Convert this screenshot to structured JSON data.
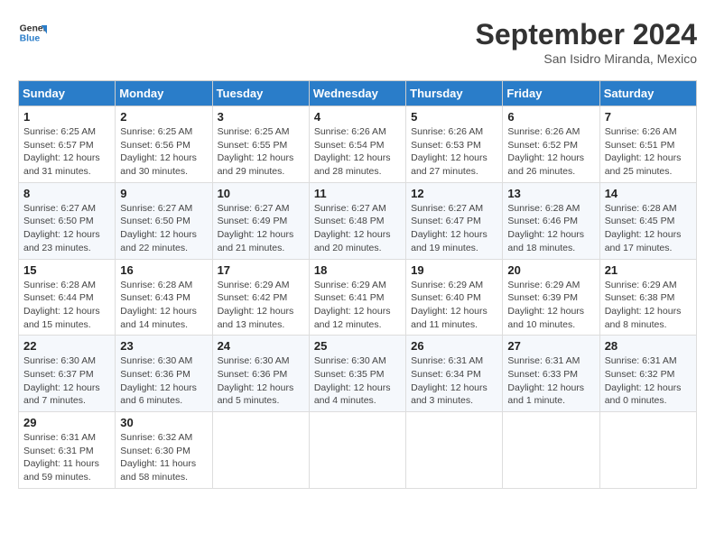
{
  "logo": {
    "text_general": "General",
    "text_blue": "Blue"
  },
  "calendar": {
    "title": "September 2024",
    "subtitle": "San Isidro Miranda, Mexico"
  },
  "headers": [
    "Sunday",
    "Monday",
    "Tuesday",
    "Wednesday",
    "Thursday",
    "Friday",
    "Saturday"
  ],
  "weeks": [
    [
      {
        "day": "1",
        "sunrise": "6:25 AM",
        "sunset": "6:57 PM",
        "daylight": "12 hours and 31 minutes."
      },
      {
        "day": "2",
        "sunrise": "6:25 AM",
        "sunset": "6:56 PM",
        "daylight": "12 hours and 30 minutes."
      },
      {
        "day": "3",
        "sunrise": "6:25 AM",
        "sunset": "6:55 PM",
        "daylight": "12 hours and 29 minutes."
      },
      {
        "day": "4",
        "sunrise": "6:26 AM",
        "sunset": "6:54 PM",
        "daylight": "12 hours and 28 minutes."
      },
      {
        "day": "5",
        "sunrise": "6:26 AM",
        "sunset": "6:53 PM",
        "daylight": "12 hours and 27 minutes."
      },
      {
        "day": "6",
        "sunrise": "6:26 AM",
        "sunset": "6:52 PM",
        "daylight": "12 hours and 26 minutes."
      },
      {
        "day": "7",
        "sunrise": "6:26 AM",
        "sunset": "6:51 PM",
        "daylight": "12 hours and 25 minutes."
      }
    ],
    [
      {
        "day": "8",
        "sunrise": "6:27 AM",
        "sunset": "6:50 PM",
        "daylight": "12 hours and 23 minutes."
      },
      {
        "day": "9",
        "sunrise": "6:27 AM",
        "sunset": "6:50 PM",
        "daylight": "12 hours and 22 minutes."
      },
      {
        "day": "10",
        "sunrise": "6:27 AM",
        "sunset": "6:49 PM",
        "daylight": "12 hours and 21 minutes."
      },
      {
        "day": "11",
        "sunrise": "6:27 AM",
        "sunset": "6:48 PM",
        "daylight": "12 hours and 20 minutes."
      },
      {
        "day": "12",
        "sunrise": "6:27 AM",
        "sunset": "6:47 PM",
        "daylight": "12 hours and 19 minutes."
      },
      {
        "day": "13",
        "sunrise": "6:28 AM",
        "sunset": "6:46 PM",
        "daylight": "12 hours and 18 minutes."
      },
      {
        "day": "14",
        "sunrise": "6:28 AM",
        "sunset": "6:45 PM",
        "daylight": "12 hours and 17 minutes."
      }
    ],
    [
      {
        "day": "15",
        "sunrise": "6:28 AM",
        "sunset": "6:44 PM",
        "daylight": "12 hours and 15 minutes."
      },
      {
        "day": "16",
        "sunrise": "6:28 AM",
        "sunset": "6:43 PM",
        "daylight": "12 hours and 14 minutes."
      },
      {
        "day": "17",
        "sunrise": "6:29 AM",
        "sunset": "6:42 PM",
        "daylight": "12 hours and 13 minutes."
      },
      {
        "day": "18",
        "sunrise": "6:29 AM",
        "sunset": "6:41 PM",
        "daylight": "12 hours and 12 minutes."
      },
      {
        "day": "19",
        "sunrise": "6:29 AM",
        "sunset": "6:40 PM",
        "daylight": "12 hours and 11 minutes."
      },
      {
        "day": "20",
        "sunrise": "6:29 AM",
        "sunset": "6:39 PM",
        "daylight": "12 hours and 10 minutes."
      },
      {
        "day": "21",
        "sunrise": "6:29 AM",
        "sunset": "6:38 PM",
        "daylight": "12 hours and 8 minutes."
      }
    ],
    [
      {
        "day": "22",
        "sunrise": "6:30 AM",
        "sunset": "6:37 PM",
        "daylight": "12 hours and 7 minutes."
      },
      {
        "day": "23",
        "sunrise": "6:30 AM",
        "sunset": "6:36 PM",
        "daylight": "12 hours and 6 minutes."
      },
      {
        "day": "24",
        "sunrise": "6:30 AM",
        "sunset": "6:36 PM",
        "daylight": "12 hours and 5 minutes."
      },
      {
        "day": "25",
        "sunrise": "6:30 AM",
        "sunset": "6:35 PM",
        "daylight": "12 hours and 4 minutes."
      },
      {
        "day": "26",
        "sunrise": "6:31 AM",
        "sunset": "6:34 PM",
        "daylight": "12 hours and 3 minutes."
      },
      {
        "day": "27",
        "sunrise": "6:31 AM",
        "sunset": "6:33 PM",
        "daylight": "12 hours and 1 minute."
      },
      {
        "day": "28",
        "sunrise": "6:31 AM",
        "sunset": "6:32 PM",
        "daylight": "12 hours and 0 minutes."
      }
    ],
    [
      {
        "day": "29",
        "sunrise": "6:31 AM",
        "sunset": "6:31 PM",
        "daylight": "11 hours and 59 minutes."
      },
      {
        "day": "30",
        "sunrise": "6:32 AM",
        "sunset": "6:30 PM",
        "daylight": "11 hours and 58 minutes."
      },
      null,
      null,
      null,
      null,
      null
    ]
  ]
}
